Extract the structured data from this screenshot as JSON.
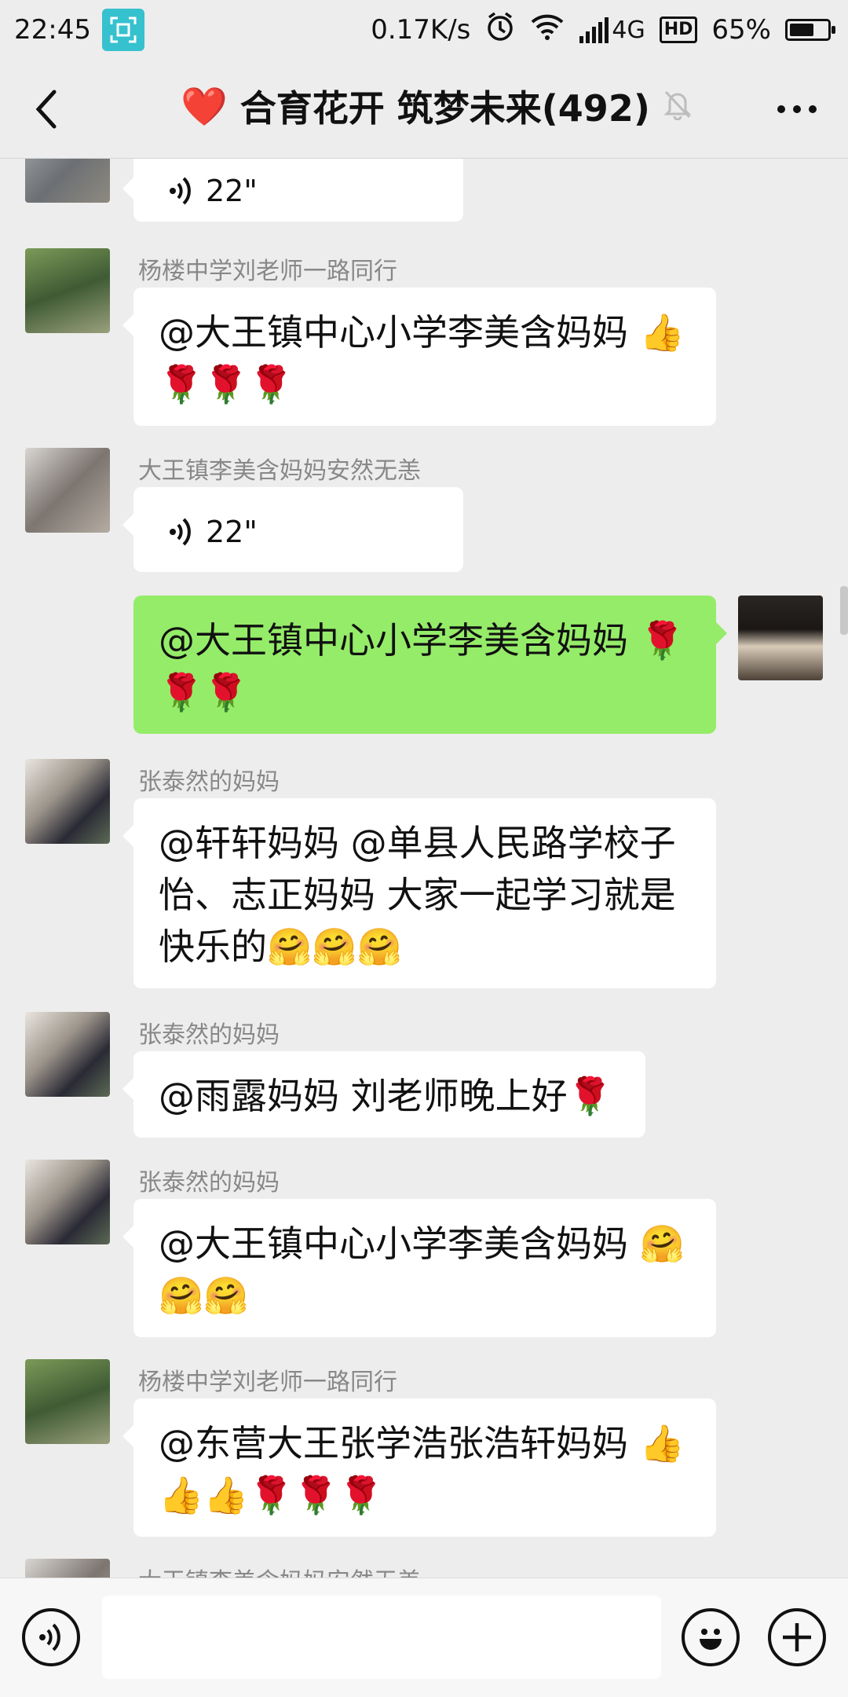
{
  "status_bar": {
    "time": "22:45",
    "net_speed": "0.17K/s",
    "network_type": "4G",
    "hd": "HD",
    "battery": "65%",
    "battery_level": 0.65
  },
  "header": {
    "emoji": "❤️",
    "title": "合育花开 筑梦未来(492)"
  },
  "messages": [
    {
      "voice_duration": "22\""
    },
    {
      "sender": "杨楼中学刘老师一路同行",
      "line1": "@大王镇中心小学李美含妈妈 👍",
      "line2": "🌹🌹🌹"
    },
    {
      "sender": "大王镇李美含妈妈安然无恙",
      "voice_duration": "22\""
    },
    {
      "line1": "@大王镇中心小学李美含妈妈 🌹",
      "line2": "🌹🌹"
    },
    {
      "sender": "张泰然的妈妈",
      "line1": "@轩轩妈妈 @单县人民路学校子",
      "line2": "怡、志正妈妈 大家一起学习就是",
      "line3": "快乐的🤗🤗🤗"
    },
    {
      "sender": "张泰然的妈妈",
      "line1": "@雨露妈妈 刘老师晚上好🌹"
    },
    {
      "sender": "张泰然的妈妈",
      "line1": "@大王镇中心小学李美含妈妈 🤗",
      "line2": "🤗🤗"
    },
    {
      "sender": "杨楼中学刘老师一路同行",
      "line1": "@东营大王张学浩张浩轩妈妈 👍",
      "line2": "👍👍🌹🌹🌹"
    },
    {
      "sender": "大王镇李美含妈妈安然无恙"
    }
  ],
  "input": {
    "placeholder": ""
  }
}
